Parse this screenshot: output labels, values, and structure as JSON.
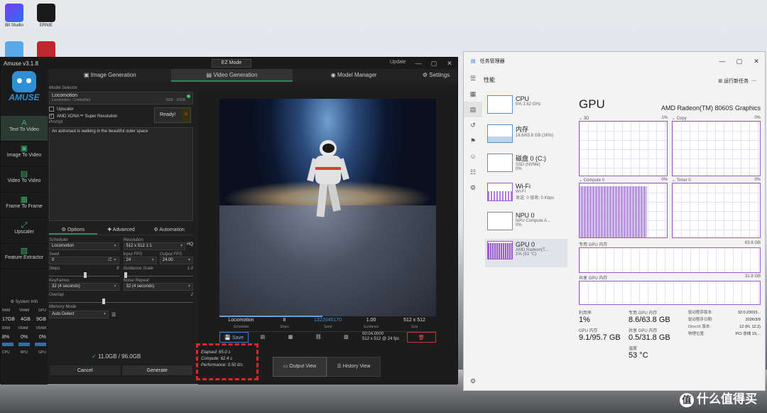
{
  "desktop": {
    "icons": [
      {
        "label": "Bit Studio"
      },
      {
        "label": "ERNIE"
      },
      {
        "label": ""
      },
      {
        "label": ""
      }
    ],
    "watermark": "什么值得买",
    "watermark_glyph": "值"
  },
  "amuse": {
    "title": "Amuse v3.1.8",
    "ez_mode": "EZ Mode",
    "update": "Update",
    "tabs": [
      "Image Generation",
      "Video Generation",
      "Model Manager"
    ],
    "settings": "Settings",
    "logo_text": "AMUSE",
    "sidebar": [
      {
        "icon": "A",
        "label": "Text To Video"
      },
      {
        "icon": "▣",
        "label": "Image To Video"
      },
      {
        "icon": "▤",
        "label": "Video To Video"
      },
      {
        "icon": "▦",
        "label": "Frame To Frame"
      },
      {
        "icon": "⤢",
        "label": "Upscaler"
      },
      {
        "icon": "▧",
        "label": "Feature Extractor"
      }
    ],
    "sysinfo": {
      "title": "System Info",
      "headers": [
        "RAM",
        "VRAM",
        "GPU"
      ],
      "values": [
        "17GB",
        "4GB",
        "9GB"
      ],
      "labels": [
        "RAM",
        "VRAM",
        "VRAM"
      ],
      "percents": [
        "8%",
        "0%",
        "0%"
      ],
      "foot": [
        "CPU",
        "NPU",
        "GPU"
      ]
    },
    "model_selector": {
      "label": "Model Selector",
      "name": "Locomotion",
      "sub": "Locomotion - ControlNet",
      "size": "6GB - 10GB"
    },
    "upscaler": "Upscaler",
    "super_res": "AMD XDNA™ Super Resolution",
    "ready": "Ready!",
    "prompt_label": "Prompt",
    "prompt": "An astronaut is walking in the beautiful outer space",
    "option_tabs": [
      "Options",
      "Advanced",
      "Automation"
    ],
    "fields": {
      "scheduler_label": "Scheduler",
      "scheduler": "Locomotion",
      "resolution_label": "Resolution",
      "resolution": "512 x 512",
      "ratio": "1:1",
      "hq": "HQ",
      "seed_label": "Seed",
      "seed": "0",
      "input_fps_label": "Input FPS",
      "input_fps": "24",
      "output_fps_label": "Output FPS",
      "output_fps": "24.00",
      "steps_label": "Steps",
      "steps_max": "8",
      "guidance_label": "Guidance Scale",
      "guidance_max": "1.0",
      "keyframes_label": "Keyframes",
      "keyframes": "32 (4 seconds)",
      "noise_label": "Noise Repeat",
      "noise": "32 (4 seconds)",
      "overlap_label": "Overlap",
      "overlap_max": "2",
      "memory_label": "Memory Mode",
      "memory": "Auto Detect"
    },
    "vram": "11.0GB / 96.0GB",
    "cancel": "Cancel",
    "generate": "Generate",
    "video_info": {
      "values": [
        "Locomotion",
        "8",
        "1322045170",
        "1.00",
        "512 x 512"
      ],
      "labels": [
        "Scheduler",
        "Steps",
        "Seed",
        "Guidance",
        "Size"
      ]
    },
    "toolbar": {
      "save": "Save",
      "time": "00:04.0000",
      "time2": "512 x 512 @ 24 fps"
    },
    "stats": {
      "elapsed_label": "Elapsed:",
      "elapsed": "65.0 s",
      "compute_label": "Compute:",
      "compute": "62.4 s",
      "perf_label": "Performance:",
      "perf": "0.50 it/s"
    },
    "view": {
      "output": "Output View",
      "history": "History View"
    }
  },
  "taskmgr": {
    "title": "任务管理器",
    "header": "性能",
    "run_task": "运行新任务",
    "items": [
      {
        "name": "CPU",
        "sub": "5%  3.62 GHz",
        "sub2": ""
      },
      {
        "name": "内存",
        "sub": "16.6/63.8 GB (26%)",
        "sub2": ""
      },
      {
        "name": "磁盘 0 (C:)",
        "sub": "SSD (NVMe)",
        "sub2": "0%"
      },
      {
        "name": "Wi-Fi",
        "sub": "Wi-Fi",
        "sub2": "发送: 0 接收: 0 Kbps"
      },
      {
        "name": "NPU 0",
        "sub": "NPU Compute A...",
        "sub2": "0%"
      },
      {
        "name": "GPU 0",
        "sub": "AMD Radeon(T...",
        "sub2": "1% (53 °C)"
      }
    ],
    "gpu": {
      "title": "GPU",
      "model": "AMD Radeon(TM) 8060S Graphics",
      "graphs": [
        {
          "name": "3D",
          "pct": "1%"
        },
        {
          "name": "Copy",
          "pct": "0%"
        },
        {
          "name": "Compute 0",
          "pct": "0%"
        },
        {
          "name": "Timer 0",
          "pct": "0%"
        }
      ],
      "dedicated_label": "专用 GPU 内存",
      "dedicated_max": "63.8 GB",
      "shared_label": "共享 GPU 内存",
      "shared_max": "31.8 GB",
      "util_label": "利用率",
      "util": "1%",
      "ded_label": "专用 GPU 内存",
      "ded": "8.6/63.8 GB",
      "gmem_label": "GPU 内存",
      "gmem": "9.1/95.7 GB",
      "shr_label": "共享 GPU 内存",
      "shr": "0.5/31.8 GB",
      "temp_label": "温度",
      "temp": "53 °C",
      "kv": [
        {
          "k": "驱动程序版本:",
          "v": "32.0.23033..."
        },
        {
          "k": "驱动程序日期:",
          "v": "2026/3/9"
        },
        {
          "k": "DirectX 版本:",
          "v": "12 (FL 12.2)"
        },
        {
          "k": "物理位置:",
          "v": "PCI 总线 19,..."
        }
      ]
    }
  }
}
